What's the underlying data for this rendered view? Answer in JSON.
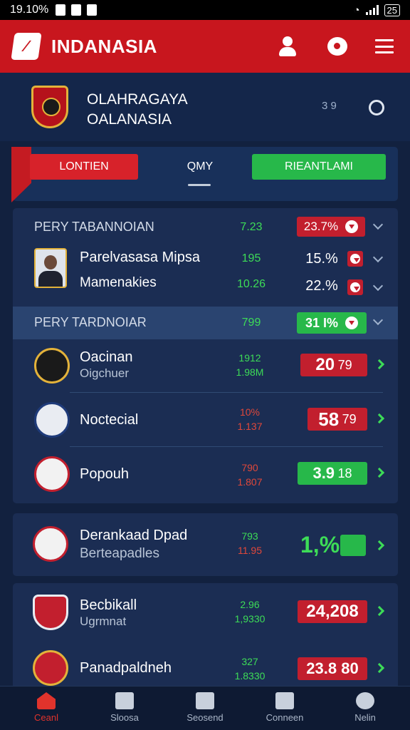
{
  "status_bar": {
    "time": "19.10%",
    "battery": "25"
  },
  "app": {
    "brand": "INDANASIA",
    "logo_icon": "shield-logo-icon"
  },
  "hero": {
    "title_line1": "OLAHRAGAYA",
    "title_line2": "OALANASIA",
    "value": "3 9"
  },
  "tabs": {
    "left": "LONTIEN",
    "middle": "QMY",
    "right": "RIEANTLAMI"
  },
  "section1": {
    "title": "PERY TABANNOIAN",
    "value": "7.23",
    "pill": "23.7%",
    "rows": [
      {
        "name": "Parelvasasa Mipsa",
        "value": "195",
        "pct": "15.%"
      },
      {
        "name": "Mamenakies",
        "value": "10.26",
        "pct": "22.%"
      }
    ]
  },
  "section2": {
    "title": "PERY TARDNOIAR",
    "value": "799",
    "pill": "31 I%",
    "teams": [
      {
        "name": "Oacinan",
        "sub": "Oigchuer",
        "v1": "1912",
        "v2": "1.98M",
        "score_main": "20",
        "score_sub": "79",
        "color": "red"
      },
      {
        "name": "Noctecial",
        "sub": "",
        "v1": "10%",
        "v2": "1.137",
        "score_main": "58",
        "score_sub": "79",
        "color": "red"
      },
      {
        "name": "Popouh",
        "sub": "",
        "v1": "790",
        "v2": "1.807",
        "score_main": "3.9",
        "score_sub": "18",
        "color": "green"
      }
    ]
  },
  "card2": {
    "name": "Derankaad Dpad",
    "sub": "Berteapadles",
    "v1": "793",
    "v2": "11.95",
    "score": "1,%"
  },
  "card3": {
    "rows": [
      {
        "name": "Becbikall",
        "sub": "Ugrmnat",
        "v1": "2.96",
        "v2": "1,9330",
        "score": "24,208"
      },
      {
        "name": "Panadpaldneh",
        "sub": "",
        "v1": "327",
        "v2": "1.8330",
        "score": "23.8 80"
      }
    ]
  },
  "nav": [
    {
      "label": "Ceanl",
      "icon": "home-icon",
      "active": true
    },
    {
      "label": "Sloosa",
      "icon": "book-icon",
      "active": false
    },
    {
      "label": "Seosend",
      "icon": "clipboard-icon",
      "active": false
    },
    {
      "label": "Conneen",
      "icon": "chat-icon",
      "active": false
    },
    {
      "label": "Nelin",
      "icon": "search-icon",
      "active": false
    }
  ],
  "colors": {
    "brand_red": "#c8161e",
    "accent_green": "#27b84a",
    "background": "#12213f",
    "card": "#1b2d53"
  }
}
